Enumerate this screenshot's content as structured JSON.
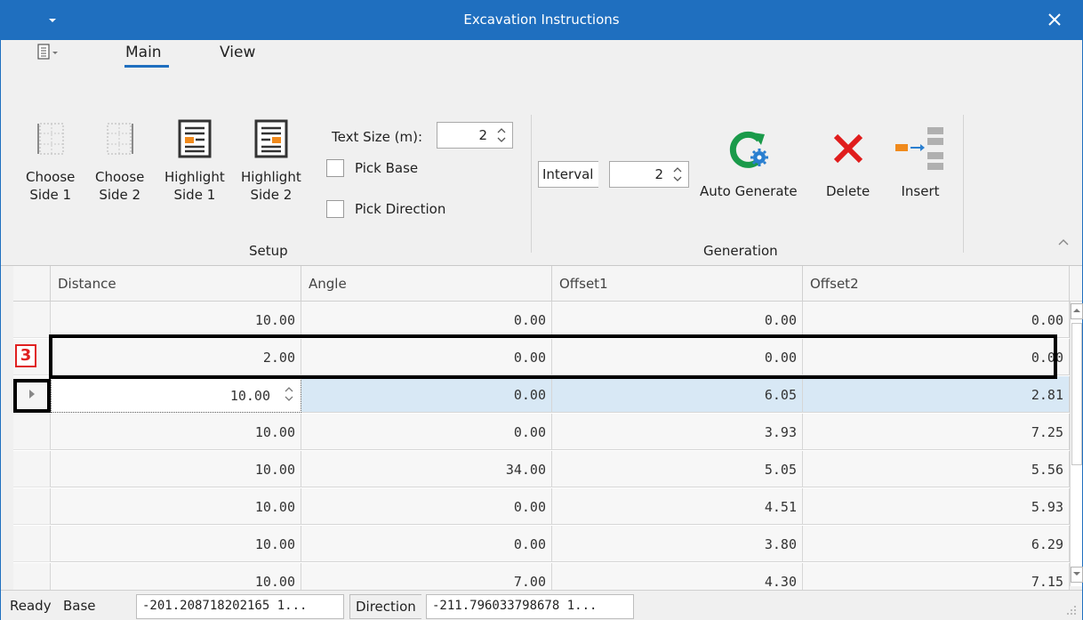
{
  "window": {
    "title": "Excavation Instructions"
  },
  "ribbon": {
    "tabs": [
      {
        "label": "Main",
        "active": true
      },
      {
        "label": "View",
        "active": false
      }
    ],
    "setup": {
      "group_label": "Setup",
      "choose_side1": [
        "Choose",
        "Side 1"
      ],
      "choose_side2": [
        "Choose",
        "Side 2"
      ],
      "highlight_side1": [
        "Highlight",
        "Side 1"
      ],
      "highlight_side2": [
        "Highlight",
        "Side 2"
      ],
      "text_size_label": "Text Size (m):",
      "text_size_value": "2",
      "pick_base_label": "Pick Base",
      "pick_direction_label": "Pick Direction"
    },
    "generation": {
      "group_label": "Generation",
      "interval_label": "Interval",
      "interval_value": "2",
      "auto_generate_label": "Auto Generate",
      "delete_label": "Delete",
      "insert_label": "Insert"
    }
  },
  "grid": {
    "columns": [
      "Distance",
      "Angle",
      "Offset1",
      "Offset2"
    ],
    "rows": [
      [
        "10.00",
        "0.00",
        "0.00",
        "0.00"
      ],
      [
        "2.00",
        "0.00",
        "0.00",
        "0.00"
      ],
      [
        "10.00",
        "0.00",
        "6.05",
        "2.81"
      ],
      [
        "10.00",
        "0.00",
        "3.93",
        "7.25"
      ],
      [
        "10.00",
        "34.00",
        "5.05",
        "5.56"
      ],
      [
        "10.00",
        "0.00",
        "4.51",
        "5.93"
      ],
      [
        "10.00",
        "0.00",
        "3.80",
        "6.29"
      ],
      [
        "10.00",
        "7.00",
        "4.30",
        "7.15"
      ]
    ],
    "selected_row": 2
  },
  "annotation": {
    "badge": "3"
  },
  "status": {
    "ready": "Ready",
    "base_label": "Base",
    "base_value": "-201.208718202165 1...",
    "direction_label": "Direction",
    "direction_value": "-211.796033798678 1..."
  },
  "colors": {
    "accent": "#1f6fbf",
    "selection": "#d8e8f5",
    "delete_red": "#e01c1c",
    "auto_green": "#1a9a4a"
  }
}
